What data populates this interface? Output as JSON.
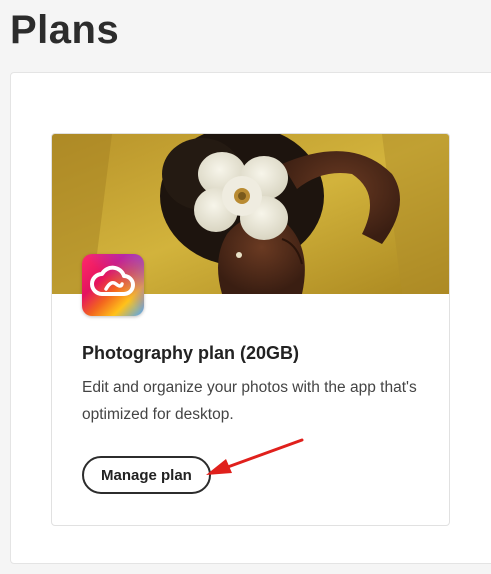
{
  "page": {
    "title": "Plans"
  },
  "plan_card": {
    "title": "Photography plan (20GB)",
    "description": "Edit and organize your photos with the app that's optimized for desktop.",
    "manage_button_label": "Manage plan",
    "app_icon": "creative-cloud-icon"
  },
  "colors": {
    "hero_background": "#c9a530",
    "annotation_arrow": "#e0201c",
    "button_border": "#2c2c2c"
  }
}
